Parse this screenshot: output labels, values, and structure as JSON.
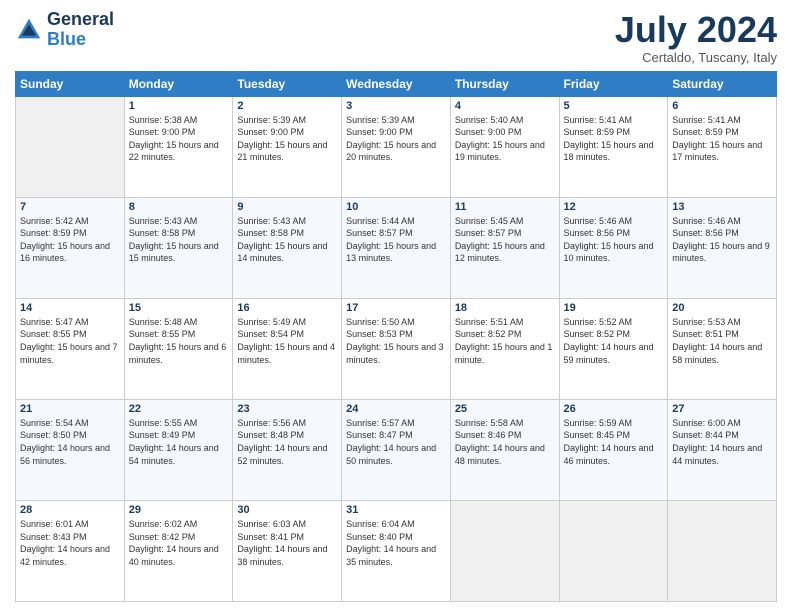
{
  "header": {
    "logo_line1": "General",
    "logo_line2": "Blue",
    "month_title": "July 2024",
    "location": "Certaldo, Tuscany, Italy"
  },
  "weekdays": [
    "Sunday",
    "Monday",
    "Tuesday",
    "Wednesday",
    "Thursday",
    "Friday",
    "Saturday"
  ],
  "weeks": [
    [
      {
        "day": "",
        "empty": true
      },
      {
        "day": "1",
        "sunrise": "Sunrise: 5:38 AM",
        "sunset": "Sunset: 9:00 PM",
        "daylight": "Daylight: 15 hours and 22 minutes."
      },
      {
        "day": "2",
        "sunrise": "Sunrise: 5:39 AM",
        "sunset": "Sunset: 9:00 PM",
        "daylight": "Daylight: 15 hours and 21 minutes."
      },
      {
        "day": "3",
        "sunrise": "Sunrise: 5:39 AM",
        "sunset": "Sunset: 9:00 PM",
        "daylight": "Daylight: 15 hours and 20 minutes."
      },
      {
        "day": "4",
        "sunrise": "Sunrise: 5:40 AM",
        "sunset": "Sunset: 9:00 PM",
        "daylight": "Daylight: 15 hours and 19 minutes."
      },
      {
        "day": "5",
        "sunrise": "Sunrise: 5:41 AM",
        "sunset": "Sunset: 8:59 PM",
        "daylight": "Daylight: 15 hours and 18 minutes."
      },
      {
        "day": "6",
        "sunrise": "Sunrise: 5:41 AM",
        "sunset": "Sunset: 8:59 PM",
        "daylight": "Daylight: 15 hours and 17 minutes."
      }
    ],
    [
      {
        "day": "7",
        "sunrise": "Sunrise: 5:42 AM",
        "sunset": "Sunset: 8:59 PM",
        "daylight": "Daylight: 15 hours and 16 minutes."
      },
      {
        "day": "8",
        "sunrise": "Sunrise: 5:43 AM",
        "sunset": "Sunset: 8:58 PM",
        "daylight": "Daylight: 15 hours and 15 minutes."
      },
      {
        "day": "9",
        "sunrise": "Sunrise: 5:43 AM",
        "sunset": "Sunset: 8:58 PM",
        "daylight": "Daylight: 15 hours and 14 minutes."
      },
      {
        "day": "10",
        "sunrise": "Sunrise: 5:44 AM",
        "sunset": "Sunset: 8:57 PM",
        "daylight": "Daylight: 15 hours and 13 minutes."
      },
      {
        "day": "11",
        "sunrise": "Sunrise: 5:45 AM",
        "sunset": "Sunset: 8:57 PM",
        "daylight": "Daylight: 15 hours and 12 minutes."
      },
      {
        "day": "12",
        "sunrise": "Sunrise: 5:46 AM",
        "sunset": "Sunset: 8:56 PM",
        "daylight": "Daylight: 15 hours and 10 minutes."
      },
      {
        "day": "13",
        "sunrise": "Sunrise: 5:46 AM",
        "sunset": "Sunset: 8:56 PM",
        "daylight": "Daylight: 15 hours and 9 minutes."
      }
    ],
    [
      {
        "day": "14",
        "sunrise": "Sunrise: 5:47 AM",
        "sunset": "Sunset: 8:55 PM",
        "daylight": "Daylight: 15 hours and 7 minutes."
      },
      {
        "day": "15",
        "sunrise": "Sunrise: 5:48 AM",
        "sunset": "Sunset: 8:55 PM",
        "daylight": "Daylight: 15 hours and 6 minutes."
      },
      {
        "day": "16",
        "sunrise": "Sunrise: 5:49 AM",
        "sunset": "Sunset: 8:54 PM",
        "daylight": "Daylight: 15 hours and 4 minutes."
      },
      {
        "day": "17",
        "sunrise": "Sunrise: 5:50 AM",
        "sunset": "Sunset: 8:53 PM",
        "daylight": "Daylight: 15 hours and 3 minutes."
      },
      {
        "day": "18",
        "sunrise": "Sunrise: 5:51 AM",
        "sunset": "Sunset: 8:52 PM",
        "daylight": "Daylight: 15 hours and 1 minute."
      },
      {
        "day": "19",
        "sunrise": "Sunrise: 5:52 AM",
        "sunset": "Sunset: 8:52 PM",
        "daylight": "Daylight: 14 hours and 59 minutes."
      },
      {
        "day": "20",
        "sunrise": "Sunrise: 5:53 AM",
        "sunset": "Sunset: 8:51 PM",
        "daylight": "Daylight: 14 hours and 58 minutes."
      }
    ],
    [
      {
        "day": "21",
        "sunrise": "Sunrise: 5:54 AM",
        "sunset": "Sunset: 8:50 PM",
        "daylight": "Daylight: 14 hours and 56 minutes."
      },
      {
        "day": "22",
        "sunrise": "Sunrise: 5:55 AM",
        "sunset": "Sunset: 8:49 PM",
        "daylight": "Daylight: 14 hours and 54 minutes."
      },
      {
        "day": "23",
        "sunrise": "Sunrise: 5:56 AM",
        "sunset": "Sunset: 8:48 PM",
        "daylight": "Daylight: 14 hours and 52 minutes."
      },
      {
        "day": "24",
        "sunrise": "Sunrise: 5:57 AM",
        "sunset": "Sunset: 8:47 PM",
        "daylight": "Daylight: 14 hours and 50 minutes."
      },
      {
        "day": "25",
        "sunrise": "Sunrise: 5:58 AM",
        "sunset": "Sunset: 8:46 PM",
        "daylight": "Daylight: 14 hours and 48 minutes."
      },
      {
        "day": "26",
        "sunrise": "Sunrise: 5:59 AM",
        "sunset": "Sunset: 8:45 PM",
        "daylight": "Daylight: 14 hours and 46 minutes."
      },
      {
        "day": "27",
        "sunrise": "Sunrise: 6:00 AM",
        "sunset": "Sunset: 8:44 PM",
        "daylight": "Daylight: 14 hours and 44 minutes."
      }
    ],
    [
      {
        "day": "28",
        "sunrise": "Sunrise: 6:01 AM",
        "sunset": "Sunset: 8:43 PM",
        "daylight": "Daylight: 14 hours and 42 minutes."
      },
      {
        "day": "29",
        "sunrise": "Sunrise: 6:02 AM",
        "sunset": "Sunset: 8:42 PM",
        "daylight": "Daylight: 14 hours and 40 minutes."
      },
      {
        "day": "30",
        "sunrise": "Sunrise: 6:03 AM",
        "sunset": "Sunset: 8:41 PM",
        "daylight": "Daylight: 14 hours and 38 minutes."
      },
      {
        "day": "31",
        "sunrise": "Sunrise: 6:04 AM",
        "sunset": "Sunset: 8:40 PM",
        "daylight": "Daylight: 14 hours and 35 minutes."
      },
      {
        "day": "",
        "empty": true
      },
      {
        "day": "",
        "empty": true
      },
      {
        "day": "",
        "empty": true
      }
    ]
  ]
}
